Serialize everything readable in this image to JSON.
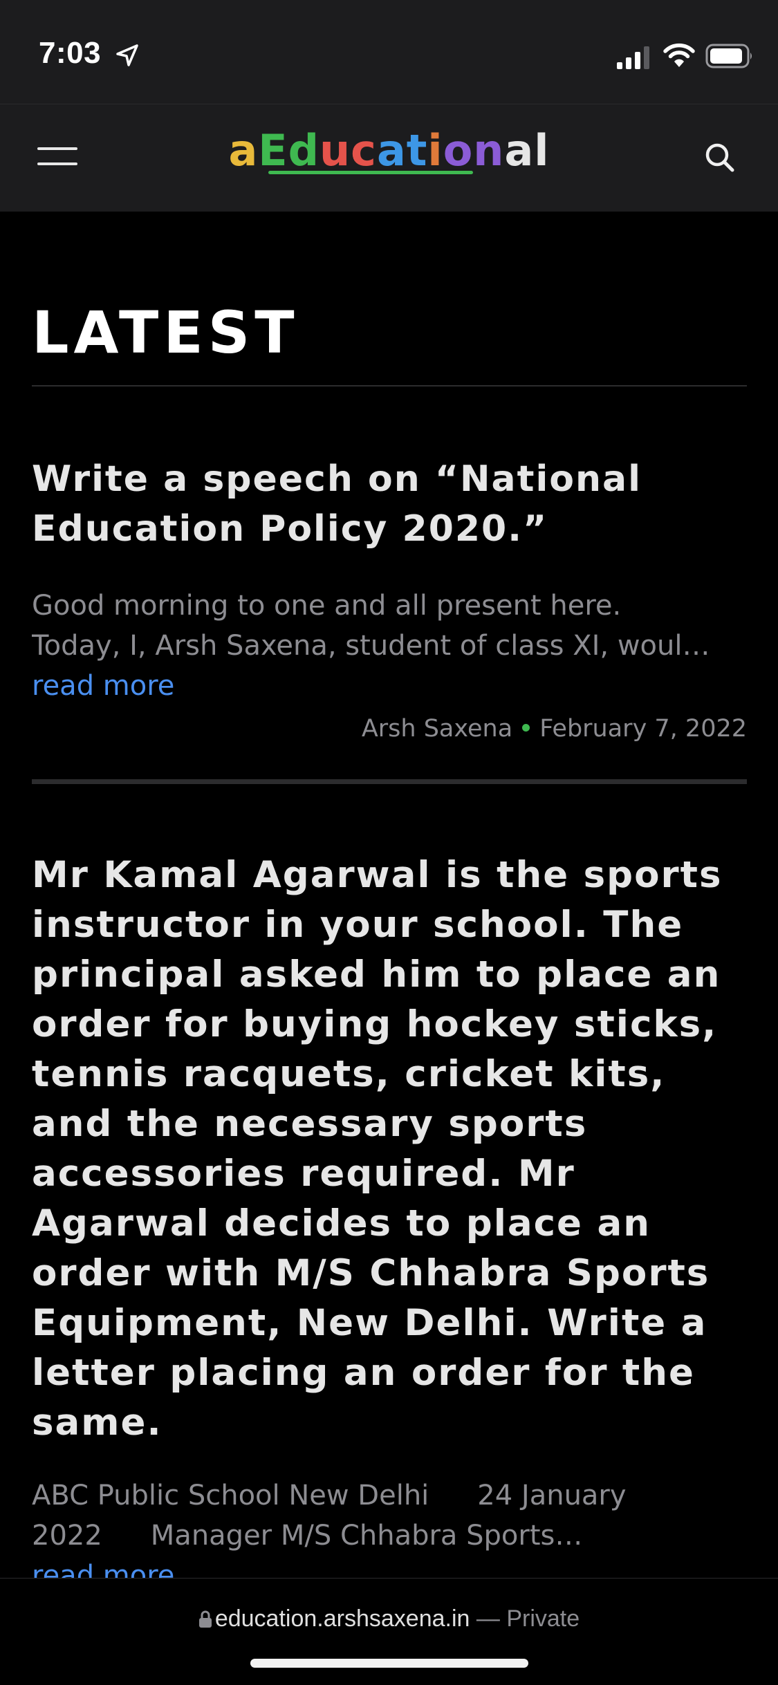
{
  "status_bar": {
    "time": "7:03",
    "icons": [
      "location-arrow-icon",
      "cellular-signal-icon",
      "wifi-icon",
      "battery-icon"
    ]
  },
  "header": {
    "logo_letters": [
      {
        "char": "a",
        "color": "#e8b93a"
      },
      {
        "char": "E",
        "color": "#3fb950"
      },
      {
        "char": "d",
        "color": "#3fb950"
      },
      {
        "char": "u",
        "color": "#e5534b"
      },
      {
        "char": "c",
        "color": "#e5534b"
      },
      {
        "char": "a",
        "color": "#3d97e6"
      },
      {
        "char": "t",
        "color": "#3d97e6"
      },
      {
        "char": "i",
        "color": "#e07a3a"
      },
      {
        "char": "o",
        "color": "#8b5cd6"
      },
      {
        "char": "n",
        "color": "#8b5cd6"
      },
      {
        "char": "a",
        "color": "#e6e6e6"
      },
      {
        "char": "l",
        "color": "#e6e6e6"
      }
    ],
    "menu_icon": "hamburger-menu-icon",
    "search_icon": "search-icon"
  },
  "main": {
    "section_title": "LATEST",
    "posts": [
      {
        "title": "Write a speech on “National Education Policy 2020.”",
        "excerpt_lines": [
          "Good morning to one and all present here.",
          "Today, I, Arsh Saxena, student of class XI, woul…"
        ],
        "read_more": "read more",
        "author": "Arsh Saxena",
        "date": "February 7, 2022"
      },
      {
        "title": "Mr Kamal Agarwal is the sports instructor in your school. The principal asked him to place an order for buying hockey sticks, tennis racquets, cricket kits, and the necessary sports accessories required. Mr Agarwal decides to place an order with M/S Chhabra Sports Equipment, New Delhi. Write a letter placing an order for the same.",
        "excerpt_line1_a": "ABC Public School New Delhi",
        "excerpt_line1_b": "24 January",
        "excerpt_line2_a": "2022",
        "excerpt_line2_b": "Manager M/S Chhabra Sports…",
        "read_more": "read more"
      }
    ]
  },
  "browser": {
    "url": "education.arshsaxena.in",
    "separator": " — ",
    "mode": "Private"
  },
  "colors": {
    "background": "#000000",
    "header_bg": "#1c1c1e",
    "link": "#4a8ff0",
    "muted_text": "#8d8d92",
    "meta_dot": "#3fb950"
  }
}
